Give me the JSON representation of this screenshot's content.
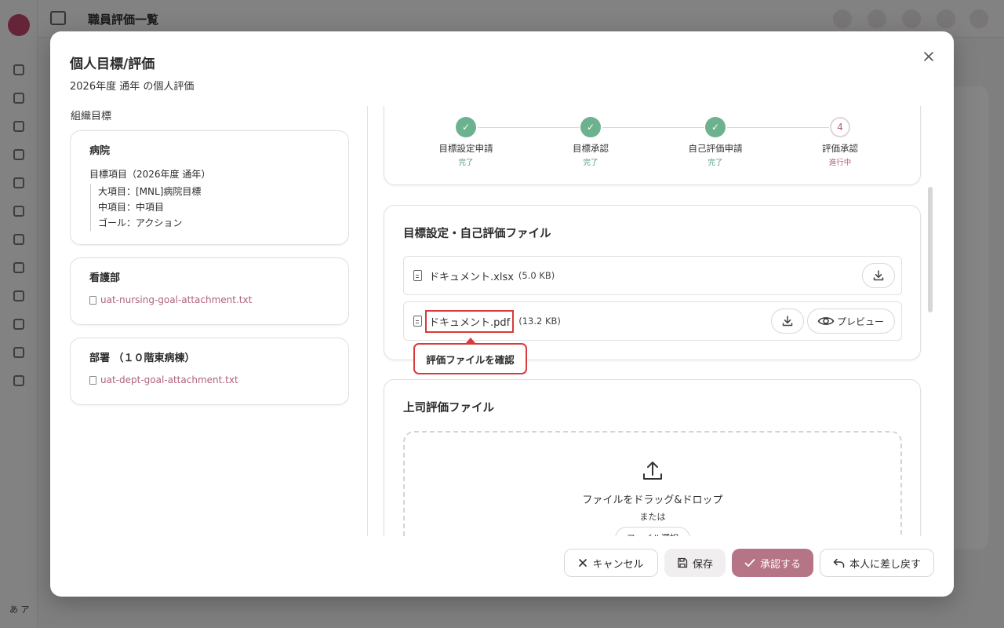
{
  "background": {
    "page_title": "職員評価一覧",
    "user_initials": "あ ア"
  },
  "modal": {
    "title": "個人目標/評価",
    "subtitle": "2026年度 通年 の個人評価",
    "close_label": "×"
  },
  "org_goals": {
    "section_label": "組織目標",
    "hospital": {
      "title": "病院",
      "item_title": "目標項目（2026年度 通年）",
      "lines": [
        "大項目：[MNL]病院目標",
        "中項目：中項目",
        "ゴール：アクション"
      ]
    },
    "nursing": {
      "title": "看護部",
      "attachment": "uat-nursing-goal-attachment.txt"
    },
    "dept": {
      "title": "部署 （１０階東病棟）",
      "attachment": "uat-dept-goal-attachment.txt"
    }
  },
  "stepper": {
    "steps": [
      {
        "label": "目標設定申請",
        "status": "完了",
        "marker": "✓"
      },
      {
        "label": "目標承認",
        "status": "完了",
        "marker": "✓"
      },
      {
        "label": "自己評価申請",
        "status": "完了",
        "marker": "✓"
      },
      {
        "label": "評価承認",
        "status": "進行中",
        "marker": "4"
      }
    ]
  },
  "self_files": {
    "title": "目標設定・自己評価ファイル",
    "files": [
      {
        "name": "ドキュメント.xlsx",
        "size": "(5.0 KB)"
      },
      {
        "name": "ドキュメント.pdf",
        "size": "(13.2 KB)"
      }
    ],
    "preview_label": "プレビュー",
    "tooltip": "評価ファイルを確認"
  },
  "supervisor_files": {
    "title": "上司評価ファイル",
    "drop_text": "ファイルをドラッグ&ドロップ",
    "or_text": "または",
    "select_label": "ファイル選択"
  },
  "footer": {
    "cancel": "キャンセル",
    "save": "保存",
    "approve": "承認する",
    "return": "本人に差し戻す"
  },
  "colors": {
    "accent": "#b67487",
    "done": "#6cb28f",
    "highlight": "#d83b3b",
    "link": "#b0627a"
  }
}
